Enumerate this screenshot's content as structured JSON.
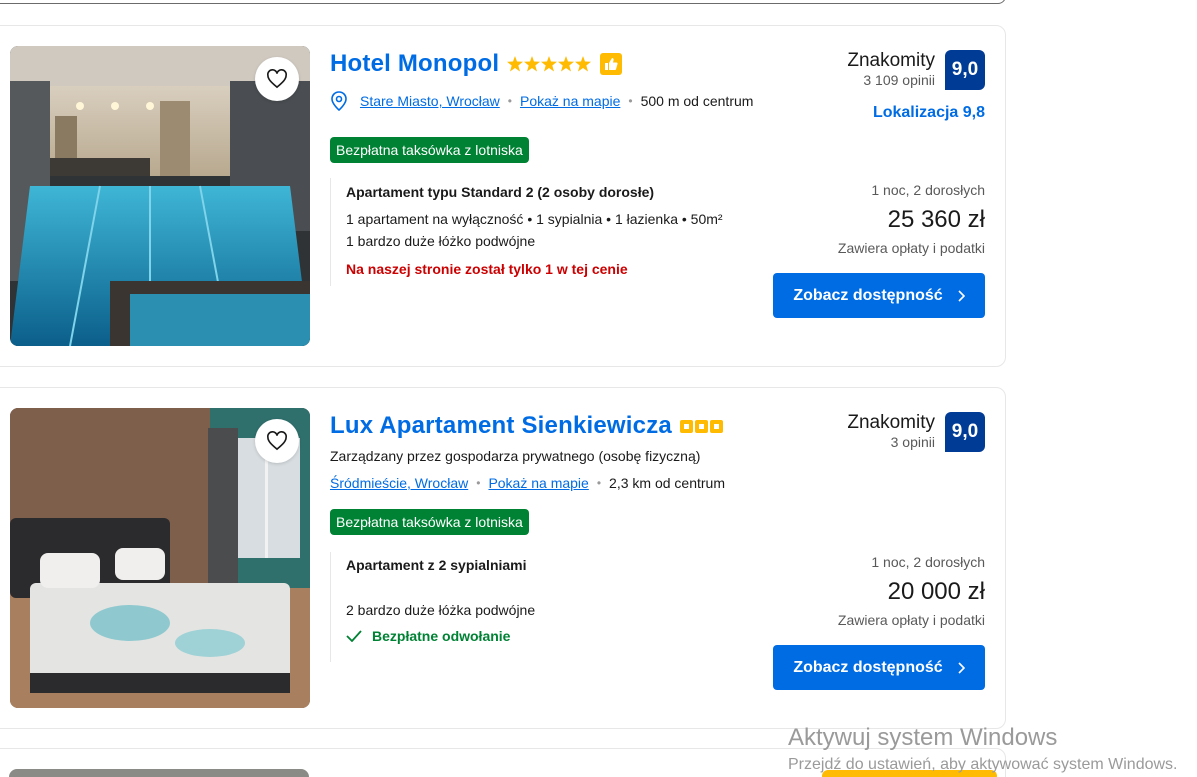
{
  "listings": [
    {
      "name": "Hotel Monopol",
      "stars": 5,
      "star_style": "star",
      "preferred_badge": true,
      "managed_by": "",
      "location": {
        "district": "Stare Miasto, Wrocław",
        "map_link": "Pokaż na mapie",
        "distance": "500 m od centrum"
      },
      "badge": "Bezpłatna taksówka z lotniska",
      "room": {
        "title": "Apartament typu Standard 2 (2 osoby dorosłe)",
        "details": "1 apartament na wyłączność • 1 sypialnia • 1 łazienka • 50m²",
        "bed": "1 bardzo duże łóżko podwójne",
        "warning": "Na naszej stronie został tylko 1 w tej cenie"
      },
      "rating": {
        "word": "Znakomity",
        "reviews": "3 109 opinii",
        "score": "9,0",
        "location_score": "Lokalizacja 9,8"
      },
      "price": {
        "meta": "1 noc, 2 dorosłych",
        "amount": "25 360 zł",
        "taxes": "Zawiera opłaty i podatki"
      },
      "cta": "Zobacz dostępność"
    },
    {
      "name": "Lux Apartament Sienkiewicza",
      "stars": 3,
      "star_style": "square",
      "preferred_badge": false,
      "managed_by": "Zarządzany przez gospodarza prywatnego (osobę fizyczną)",
      "location": {
        "district": "Śródmieście, Wrocław",
        "map_link": "Pokaż na mapie",
        "distance": "2,3 km od centrum"
      },
      "badge": "Bezpłatna taksówka z lotniska",
      "room": {
        "title": "Apartament z 2 sypialniami",
        "bed": "2 bardzo duże łóżka podwójne",
        "free_cancel": "Bezpłatne odwołanie"
      },
      "rating": {
        "word": "Znakomity",
        "reviews": "3 opinii",
        "score": "9,0"
      },
      "price": {
        "meta": "1 noc, 2 dorosłych",
        "amount": "20 000 zł",
        "taxes": "Zawiera opłaty i podatki"
      },
      "cta": "Zobacz dostępność"
    }
  ],
  "watermark": {
    "line1": "Aktywuj system Windows",
    "line2": "Przejdź do ustawień, aby aktywować system Windows."
  },
  "colors": {
    "link": "#006ce4",
    "score_bg": "#003b95",
    "badge_green": "#008234",
    "warning_red": "#cc0000",
    "star_yellow": "#febb02"
  }
}
